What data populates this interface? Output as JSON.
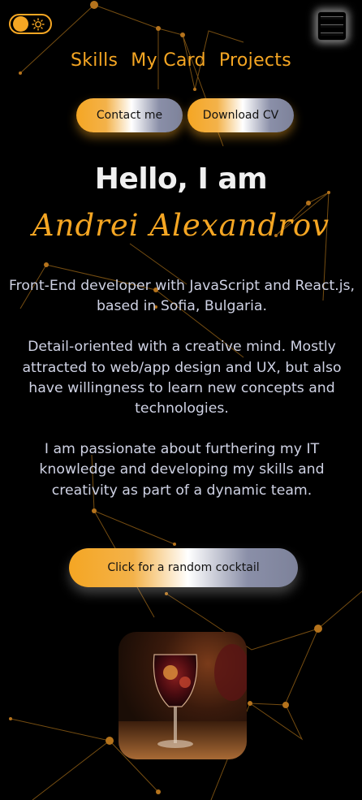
{
  "theme_toggle": {
    "state": "dark",
    "icon": "sun-icon"
  },
  "menu": {
    "icon": "hamburger-menu-icon"
  },
  "nav": {
    "items": [
      {
        "label": "Skills"
      },
      {
        "label": "My Card"
      },
      {
        "label": "Projects"
      }
    ]
  },
  "hero": {
    "contact_label": "Contact me",
    "cv_label": "Download CV",
    "greeting": "Hello, I am",
    "name": "Andrei Alexandrov"
  },
  "bio": {
    "p1": "Front-End developer with JavaScript and React.js, based in Sofia, Bulgaria.",
    "p2": "Detail-oriented with a creative mind. Mostly attracted to web/app design and UX, but also have willingness to learn new concepts and technologies.",
    "p3": "I am passionate about furthering my IT knowledge and developing my skills and creativity as part of a dynamic team."
  },
  "cocktail": {
    "button_label": "Click for a random cocktail",
    "image": "cocktail-sangria-image"
  },
  "colors": {
    "accent": "#f5a623",
    "background": "#000000",
    "text": "#cfd2e4"
  }
}
